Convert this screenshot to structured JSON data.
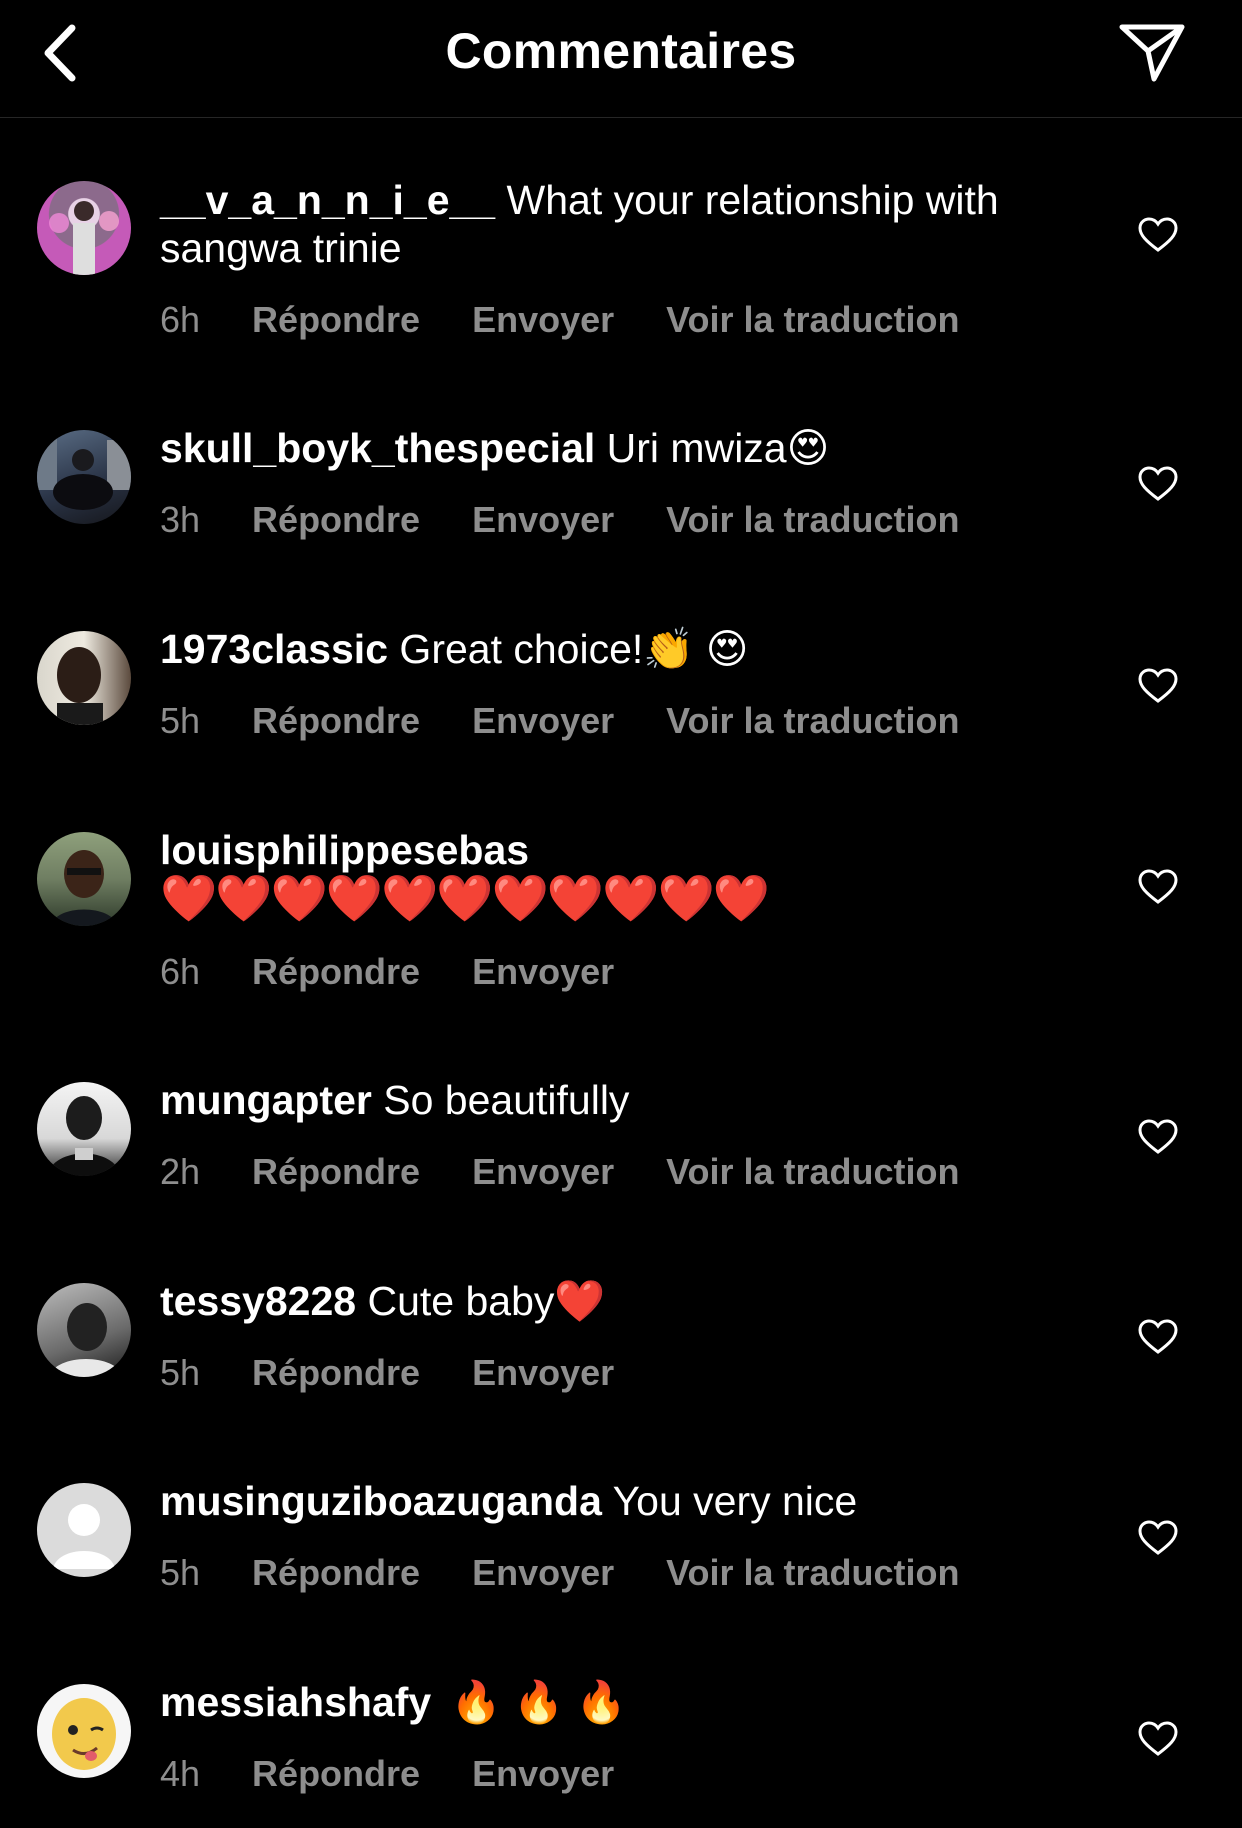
{
  "header": {
    "title": "Commentaires",
    "back_icon": "chevron-left-icon",
    "share_icon": "paper-plane-icon"
  },
  "colors": {
    "background": "#000000",
    "text": "#ffffff",
    "secondary_text": "#8e8e8e",
    "divider": "#262626",
    "heart_emoji": "#e0262f"
  },
  "actions": {
    "reply": "Répondre",
    "send": "Envoyer",
    "translate": "Voir la traduction"
  },
  "comments": [
    {
      "username": "__v_a_n_n_i_e__",
      "text": "What your relationship with sangwa trinie",
      "time": "6h",
      "translate": true
    },
    {
      "username": "skull_boyk_thespecial",
      "text": "Uri mwiza😍",
      "time": "3h",
      "translate": true
    },
    {
      "username": "1973classic",
      "text": "Great choice!👏 😍",
      "time": "5h",
      "translate": true
    },
    {
      "username": "louisphilippesebas",
      "text": "❤️❤️❤️❤️❤️❤️❤️❤️❤️❤️❤️",
      "time": "6h",
      "translate": false
    },
    {
      "username": "mungapter",
      "text": "So beautifully",
      "time": "2h",
      "translate": true
    },
    {
      "username": "tessy8228",
      "text": "Cute baby❤️",
      "time": "5h",
      "translate": false
    },
    {
      "username": "musinguziboazuganda",
      "text": "You very nice",
      "time": "5h",
      "translate": true
    },
    {
      "username": "messiahshafy",
      "text": "🔥 🔥 🔥",
      "time": "4h",
      "translate": false
    }
  ]
}
